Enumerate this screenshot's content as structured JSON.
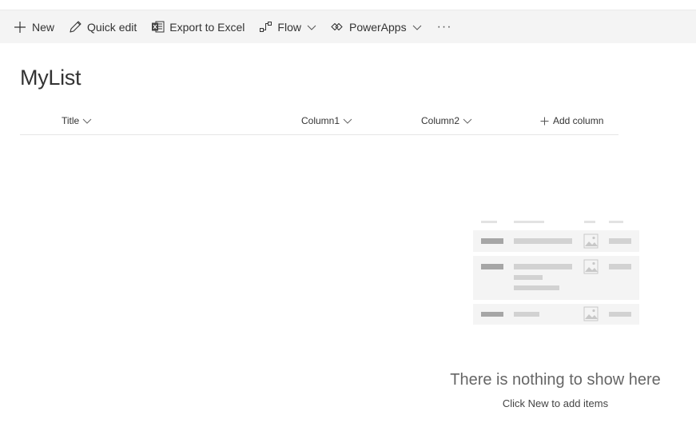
{
  "commandbar": {
    "new_label": "New",
    "quick_edit_label": "Quick edit",
    "export_label": "Export to Excel",
    "flow_label": "Flow",
    "powerapps_label": "PowerApps",
    "more_label": "···",
    "icons": {
      "new": "plus-icon",
      "quick_edit": "pencil-icon",
      "export": "excel-icon",
      "flow": "flow-icon",
      "powerapps": "powerapps-icon",
      "chevron": "chevron-down-icon"
    }
  },
  "list": {
    "title": "MyList",
    "columns": [
      {
        "label": "Title"
      },
      {
        "label": "Column1"
      },
      {
        "label": "Column2"
      }
    ],
    "add_column_label": "Add column"
  },
  "empty_state": {
    "title": "There is nothing to show here",
    "subtitle": "Click New to add items"
  },
  "colors": {
    "command_bar_bg": "#f4f4f4",
    "text": "#333333",
    "illustration_light": "#f4f4f4",
    "illustration_bar": "#d2d2d2",
    "illustration_dark": "#a6a6a6"
  }
}
